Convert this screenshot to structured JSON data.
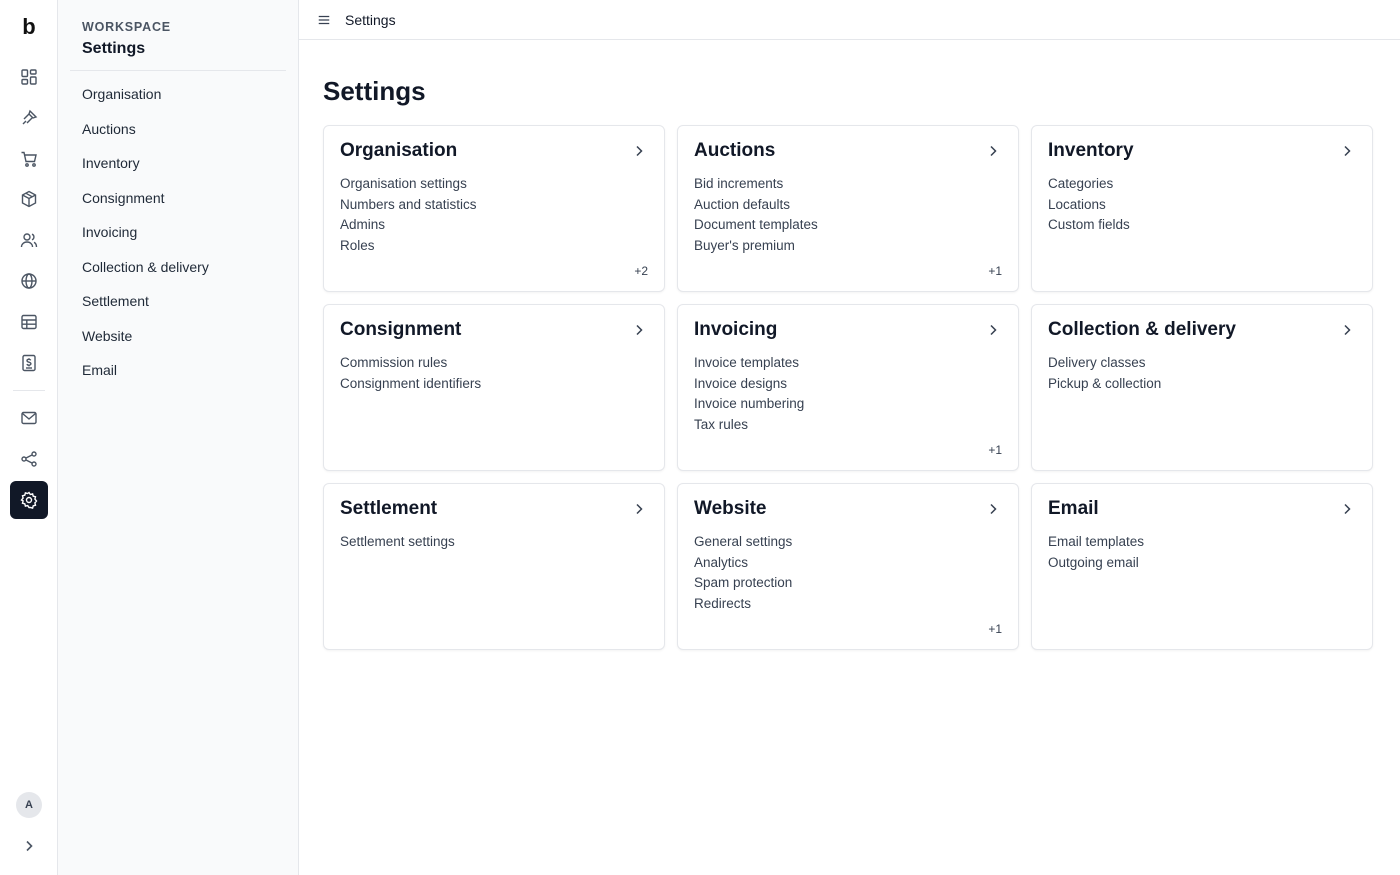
{
  "app": {
    "logo": "b"
  },
  "rail": {
    "icons": [
      "dashboard-icon",
      "gavel-icon",
      "cart-icon",
      "box-icon",
      "users-icon",
      "globe-icon",
      "table-icon",
      "invoice-icon",
      "mail-icon",
      "share-icon",
      "gear-icon"
    ],
    "active": "gear-icon",
    "avatar": "A"
  },
  "subnav": {
    "section_label": "WORKSPACE",
    "title": "Settings",
    "items": [
      {
        "label": "Organisation"
      },
      {
        "label": "Auctions"
      },
      {
        "label": "Inventory"
      },
      {
        "label": "Consignment"
      },
      {
        "label": "Invoicing"
      },
      {
        "label": "Collection & delivery"
      },
      {
        "label": "Settlement"
      },
      {
        "label": "Website"
      },
      {
        "label": "Email"
      }
    ]
  },
  "topbar": {
    "title": "Settings"
  },
  "page": {
    "title": "Settings"
  },
  "cards": [
    {
      "title": "Organisation",
      "items": [
        "Organisation settings",
        "Numbers and statistics",
        "Admins",
        "Roles"
      ],
      "more": "+2"
    },
    {
      "title": "Auctions",
      "items": [
        "Bid increments",
        "Auction defaults",
        "Document templates",
        "Buyer's premium"
      ],
      "more": "+1"
    },
    {
      "title": "Inventory",
      "items": [
        "Categories",
        "Locations",
        "Custom fields"
      ],
      "more": ""
    },
    {
      "title": "Consignment",
      "items": [
        "Commission rules",
        "Consignment identifiers"
      ],
      "more": ""
    },
    {
      "title": "Invoicing",
      "items": [
        "Invoice templates",
        "Invoice designs",
        "Invoice numbering",
        "Tax rules"
      ],
      "more": "+1"
    },
    {
      "title": "Collection & delivery",
      "items": [
        "Delivery classes",
        "Pickup & collection"
      ],
      "more": ""
    },
    {
      "title": "Settlement",
      "items": [
        "Settlement settings"
      ],
      "more": ""
    },
    {
      "title": "Website",
      "items": [
        "General settings",
        "Analytics",
        "Spam protection",
        "Redirects"
      ],
      "more": "+1"
    },
    {
      "title": "Email",
      "items": [
        "Email templates",
        "Outgoing email"
      ],
      "more": ""
    }
  ]
}
